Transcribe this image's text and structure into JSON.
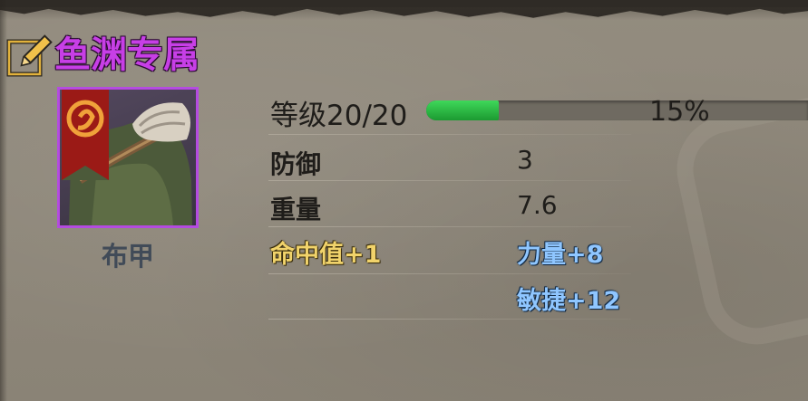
{
  "header": {
    "set_title": "鱼渊专属",
    "edit_icon": "edit-pencil-icon"
  },
  "item": {
    "name": "布甲",
    "rarity_color": "#b44be0",
    "emblem_icon": "serpent-banner-icon"
  },
  "level": {
    "label": "等级20/20",
    "percent_text": "15%",
    "progress": 0.19,
    "bar_color": "#2fbf45"
  },
  "stats": [
    {
      "name": "防御",
      "value": "3"
    },
    {
      "name": "重量",
      "value": "7.6"
    }
  ],
  "bonuses": {
    "gold": [
      "命中值+1"
    ],
    "blue": [
      "力量+8",
      "敏捷+12"
    ]
  }
}
